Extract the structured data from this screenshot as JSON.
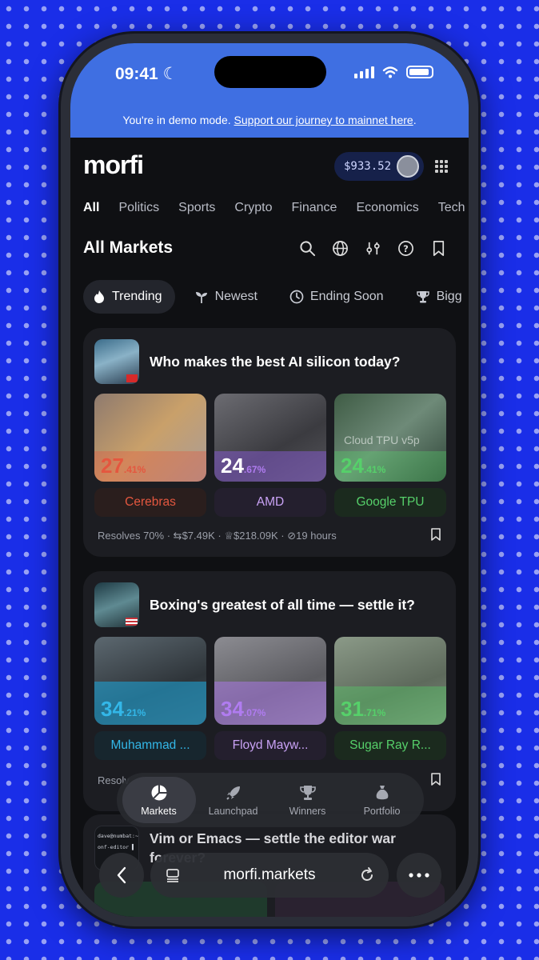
{
  "status": {
    "time": "09:41"
  },
  "banner": {
    "text": "You're in demo mode.",
    "link": "Support our journey to mainnet here",
    "suffix": "."
  },
  "header": {
    "logo": "morfi",
    "balance": "$933.52"
  },
  "categories": [
    "All",
    "Politics",
    "Sports",
    "Crypto",
    "Finance",
    "Economics",
    "Tech"
  ],
  "page_title": "All Markets",
  "filters": [
    "Trending",
    "Newest",
    "Ending Soon",
    "Bigg"
  ],
  "markets": [
    {
      "question": "Who makes the best AI silicon today?",
      "options": [
        {
          "name": "Cerebras",
          "pct_int": "27",
          "pct_dec": ".41%",
          "color": "#e4573f"
        },
        {
          "name": "AMD",
          "pct_int": "24",
          "pct_dec": ".67%",
          "color": "#b07cf0"
        },
        {
          "name": "Google TPU",
          "pct_int": "24",
          "pct_dec": ".41%",
          "color": "#56d06a"
        }
      ],
      "overlay_text": "Cloud TPU v5p",
      "resolves": "Resolves 70%",
      "volume": "$7.49K",
      "prize": "$218.09K",
      "time_left": "19 hours"
    },
    {
      "question": "Boxing's greatest of all time — settle it?",
      "options": [
        {
          "name": "Muhammad ...",
          "pct_int": "34",
          "pct_dec": ".21%",
          "color": "#33b7e8"
        },
        {
          "name": "Floyd Mayw...",
          "pct_int": "34",
          "pct_dec": ".07%",
          "color": "#b07cf0"
        },
        {
          "name": "Sugar Ray R...",
          "pct_int": "31",
          "pct_dec": ".71%",
          "color": "#56d06a"
        }
      ],
      "resolves": "Resolv"
    },
    {
      "question": "Vim or Emacs — settle the editor war",
      "question_line2": "forever?",
      "terminal_1": "dave@numbat:~$",
      "terminal_2": "onf-editor ▌"
    }
  ],
  "nav": [
    "Markets",
    "Launchpad",
    "Winners",
    "Portfolio"
  ],
  "browser": {
    "url": "morfi.markets"
  }
}
